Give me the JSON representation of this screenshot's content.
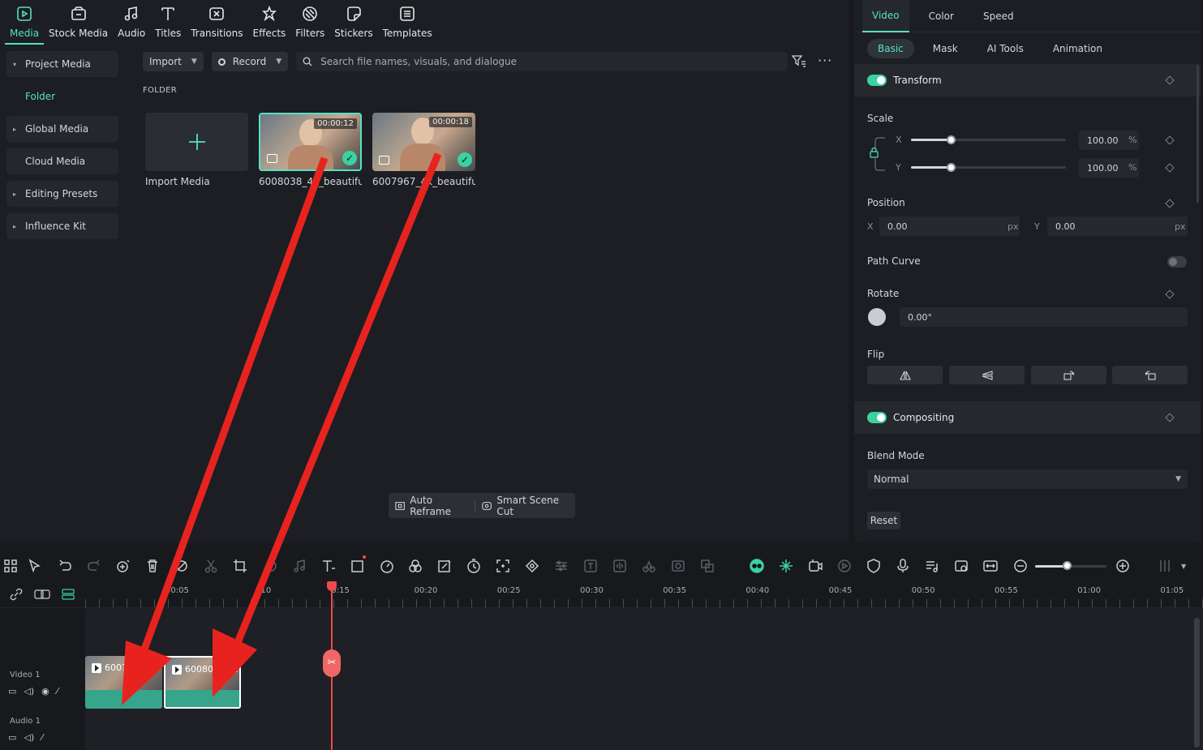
{
  "media_toolbar": {
    "items": [
      {
        "label": "Media",
        "icon": "media-icon"
      },
      {
        "label": "Stock Media",
        "icon": "stock-media-icon"
      },
      {
        "label": "Audio",
        "icon": "music-note-icon"
      },
      {
        "label": "Titles",
        "icon": "text-t-icon"
      },
      {
        "label": "Transitions",
        "icon": "transitions-icon"
      },
      {
        "label": "Effects",
        "icon": "effects-icon"
      },
      {
        "label": "Filters",
        "icon": "filters-icon"
      },
      {
        "label": "Stickers",
        "icon": "stickers-icon"
      },
      {
        "label": "Templates",
        "icon": "templates-icon"
      }
    ]
  },
  "sidebar": {
    "items": [
      {
        "label": "Project Media",
        "caret": "▾"
      },
      {
        "label": "Folder"
      },
      {
        "label": "Global Media",
        "caret": "▸"
      },
      {
        "label": "Cloud Media"
      },
      {
        "label": "Editing Presets",
        "caret": "▸"
      },
      {
        "label": "Influence Kit",
        "caret": "▸"
      }
    ]
  },
  "media": {
    "import_label": "Import",
    "record_label": "Record",
    "search_placeholder": "Search file names, visuals, and dialogue",
    "more_label": "···",
    "folder_heading": "FOLDER",
    "import_media_label": "Import Media",
    "clips": [
      {
        "duration": "00:00:12",
        "caption": "6008038_4k_beautiful_..."
      },
      {
        "duration": "00:00:18",
        "caption": "6007967_4k_beautiful_..."
      }
    ],
    "auto_reframe_label": "Auto Reframe",
    "smart_scene_cut_label": "Smart Scene Cut"
  },
  "props": {
    "tabs": [
      "Video",
      "Color",
      "Speed"
    ],
    "sub_tabs": [
      "Basic",
      "Mask",
      "AI Tools",
      "Animation"
    ],
    "transform_label": "Transform",
    "scale_label": "Scale",
    "scale_x_axis": "X",
    "scale_y_axis": "Y",
    "scale_x": "100.00",
    "scale_y": "100.00",
    "scale_level": 0.26,
    "percent_unit": "%",
    "position_label": "Position",
    "pos_x_axis": "X",
    "pos_y_axis": "Y",
    "pos_x": "0.00",
    "pos_y": "0.00",
    "px_unit": "px",
    "path_curve_label": "Path Curve",
    "rotate_label": "Rotate",
    "rotate_value": "0.00°",
    "flip_label": "Flip",
    "compositing_label": "Compositing",
    "blend_mode_label": "Blend Mode",
    "blend_mode_value": "Normal",
    "reset_label": "Reset"
  },
  "timeline": {
    "ruler_labels": [
      "00:05",
      ":10",
      "0:15",
      "00:20",
      "00:25",
      "00:30",
      "00:35",
      "00:40",
      "00:45",
      "00:50",
      "00:55",
      "01:00",
      "01:05"
    ],
    "tracks": [
      {
        "name": "Video 1"
      },
      {
        "name": "Audio 1"
      }
    ],
    "clips": [
      {
        "label": "60079...4..."
      },
      {
        "label": "600803...k..."
      }
    ],
    "zoom_level": 0.45
  },
  "colors": {
    "accent": "#56e1c4",
    "playhead": "#f04a4a",
    "clip_audio_bar": "#37a58c",
    "annotation_arrow": "#e8231f"
  }
}
